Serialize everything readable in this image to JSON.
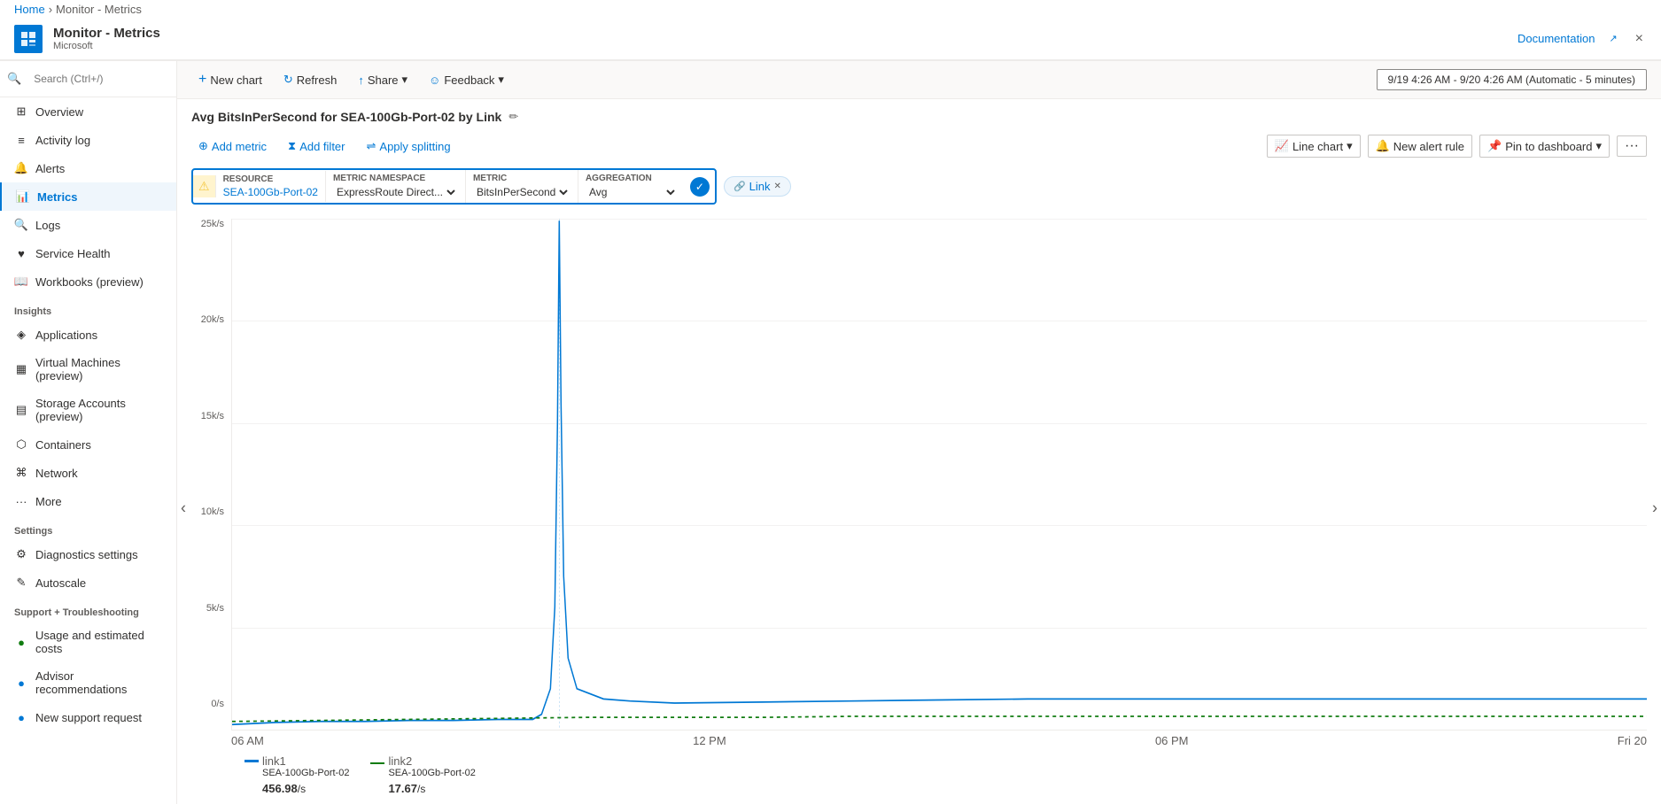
{
  "breadcrumb": {
    "home": "Home",
    "page": "Monitor - Metrics"
  },
  "header": {
    "title": "Monitor - Metrics",
    "subtitle": "Microsoft",
    "doc_link": "Documentation",
    "close_label": "×"
  },
  "sidebar": {
    "search_placeholder": "Search (Ctrl+/)",
    "items": [
      {
        "id": "overview",
        "label": "Overview",
        "icon": "grid"
      },
      {
        "id": "activity-log",
        "label": "Activity log",
        "icon": "list"
      },
      {
        "id": "alerts",
        "label": "Alerts",
        "icon": "bell"
      },
      {
        "id": "metrics",
        "label": "Metrics",
        "icon": "chart",
        "active": true
      },
      {
        "id": "logs",
        "label": "Logs",
        "icon": "search"
      },
      {
        "id": "service-health",
        "label": "Service Health",
        "icon": "heart"
      },
      {
        "id": "workbooks",
        "label": "Workbooks (preview)",
        "icon": "book"
      }
    ],
    "sections": [
      {
        "label": "Insights",
        "items": [
          {
            "id": "applications",
            "label": "Applications",
            "icon": "app"
          },
          {
            "id": "virtual-machines",
            "label": "Virtual Machines (preview)",
            "icon": "vm"
          },
          {
            "id": "storage-accounts",
            "label": "Storage Accounts (preview)",
            "icon": "storage"
          },
          {
            "id": "containers",
            "label": "Containers",
            "icon": "container"
          },
          {
            "id": "network",
            "label": "Network",
            "icon": "network"
          },
          {
            "id": "more",
            "label": "More",
            "icon": "ellipsis"
          }
        ]
      },
      {
        "label": "Settings",
        "items": [
          {
            "id": "diagnostics",
            "label": "Diagnostics settings",
            "icon": "settings"
          },
          {
            "id": "autoscale",
            "label": "Autoscale",
            "icon": "scale"
          }
        ]
      },
      {
        "label": "Support + Troubleshooting",
        "items": [
          {
            "id": "usage-costs",
            "label": "Usage and estimated costs",
            "icon": "circle-green"
          },
          {
            "id": "advisor",
            "label": "Advisor recommendations",
            "icon": "circle-blue"
          },
          {
            "id": "support",
            "label": "New support request",
            "icon": "support"
          }
        ]
      }
    ]
  },
  "toolbar": {
    "new_chart": "New chart",
    "refresh": "Refresh",
    "share": "Share",
    "feedback": "Feedback",
    "time_range": "9/19 4:26 AM - 9/20 4:26 AM (Automatic - 5 minutes)"
  },
  "chart": {
    "title": "Avg BitsInPerSecond for SEA-100Gb-Port-02 by Link",
    "add_metric": "Add metric",
    "add_filter": "Add filter",
    "apply_splitting": "Apply splitting",
    "chart_type": "Line chart",
    "new_alert": "New alert rule",
    "pin_dashboard": "Pin to dashboard",
    "resource": {
      "label": "RESOURCE",
      "value": "SEA-100Gb-Port-02"
    },
    "metric_namespace": {
      "label": "METRIC NAMESPACE",
      "value": "ExpressRoute Direct..."
    },
    "metric": {
      "label": "METRIC",
      "value": "BitsInPerSecond"
    },
    "aggregation": {
      "label": "AGGREGATION",
      "value": "Avg"
    },
    "split_by": "Link",
    "y_labels": [
      "25k/s",
      "20k/s",
      "15k/s",
      "10k/s",
      "5k/s",
      "0/s"
    ],
    "x_labels": [
      "06 AM",
      "12 PM",
      "06 PM",
      "Fri 20"
    ],
    "legend": [
      {
        "id": "link1",
        "label": "link1",
        "resource": "SEA-100Gb-Port-02",
        "color": "#0078d4",
        "value": "456.98",
        "unit": "/s"
      },
      {
        "id": "link2",
        "label": "link2",
        "resource": "SEA-100Gb-Port-02",
        "color": "#107c10",
        "value": "17.67",
        "unit": "/s"
      }
    ]
  }
}
